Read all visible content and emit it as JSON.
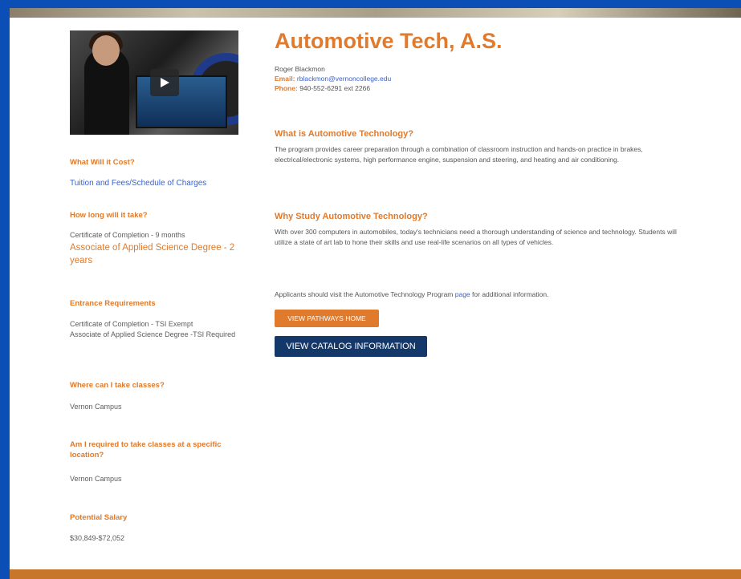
{
  "program": {
    "title": "Automotive Tech, A.S.",
    "contact_name": "Roger Blackmon",
    "email_label": "Email:",
    "email": "rblackmon@vernoncollege.edu",
    "phone_label": "Phone:",
    "phone": "940-552-6291 ext 2266"
  },
  "sidebar": {
    "cost_heading": "What Will it Cost?",
    "cost_link": "Tuition and Fees/Schedule of Charges",
    "duration_heading": "How long will it take?",
    "duration_certificate": "Certificate of Completion - 9 months",
    "duration_degree": "Associate of Applied Science Degree - 2 years",
    "requirements_heading": "Entrance Requirements",
    "requirements_certificate": "Certificate of Completion - TSI Exempt",
    "requirements_degree": "Associate of Applied Science Degree -TSI Required",
    "where_heading": "Where can I take classes?",
    "where_value": "Vernon Campus",
    "location_heading": "Am I required to take classes at a specific location?",
    "location_value": "Vernon Campus",
    "salary_heading": "Potential Salary",
    "salary_value": "$30,849-$72,052"
  },
  "main": {
    "what_heading": "What is Automotive Technology?",
    "what_text": "The program provides career preparation through a combination of classroom instruction and hands-on practice in brakes, electrical/electronic systems, high performance engine, suspension and steering, and heating and air conditioning.",
    "why_heading": "Why Study Automotive Technology?",
    "why_text": "With over 300 computers in automobiles, today's technicians need a thorough understanding of science and technology. Students will utilize a state of art lab to hone their skills and use real-life scenarios on all types of vehicles.",
    "applicants_text_before": "Applicants should visit the Automotive Technology Program ",
    "applicants_link": "page",
    "applicants_text_after": " for additional information.",
    "pathways_button": "VIEW PATHWAYS HOME",
    "catalog_button": "VIEW CATALOG INFORMATION"
  },
  "colors": {
    "accent": "#e07a2c",
    "navy": "#14386a",
    "link": "#3a62c9",
    "frame": "#0b4fb6"
  },
  "icons": {
    "play": "play-icon"
  }
}
